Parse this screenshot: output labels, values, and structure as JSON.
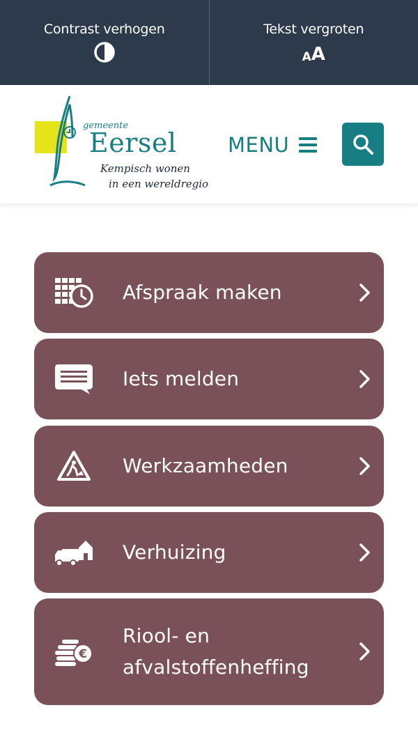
{
  "topbar": {
    "contrast_label": "Contrast verhogen",
    "contrast_icon": "contrast-icon",
    "text_label": "Tekst vergroten",
    "text_icon_small": "A",
    "text_icon_big": "A"
  },
  "logo": {
    "gemeente": "gemeente",
    "name": "Eersel",
    "tagline_line1": "Kempisch wonen",
    "tagline_line2": "in een wereldregio"
  },
  "header": {
    "menu_label": "MENU",
    "menu_icon": "hamburger-icon",
    "search_icon": "search-icon"
  },
  "colors": {
    "topbar_bg": "#2c3a4c",
    "brand_teal": "#177f84",
    "tile_bg": "#7a5059",
    "logo_yellow": "#e6e31a"
  },
  "tiles": [
    {
      "label": "Afspraak maken",
      "icon": "calendar-clock-icon"
    },
    {
      "label": "Iets melden",
      "icon": "chat-bubble-icon"
    },
    {
      "label": "Werkzaamheden",
      "icon": "roadwork-warning-icon"
    },
    {
      "label": "Verhuizing",
      "icon": "moving-truck-house-icon"
    },
    {
      "label_line1": "Riool- en",
      "label_line2": "afvalstoffenheffing",
      "icon": "coins-euro-icon"
    }
  ]
}
